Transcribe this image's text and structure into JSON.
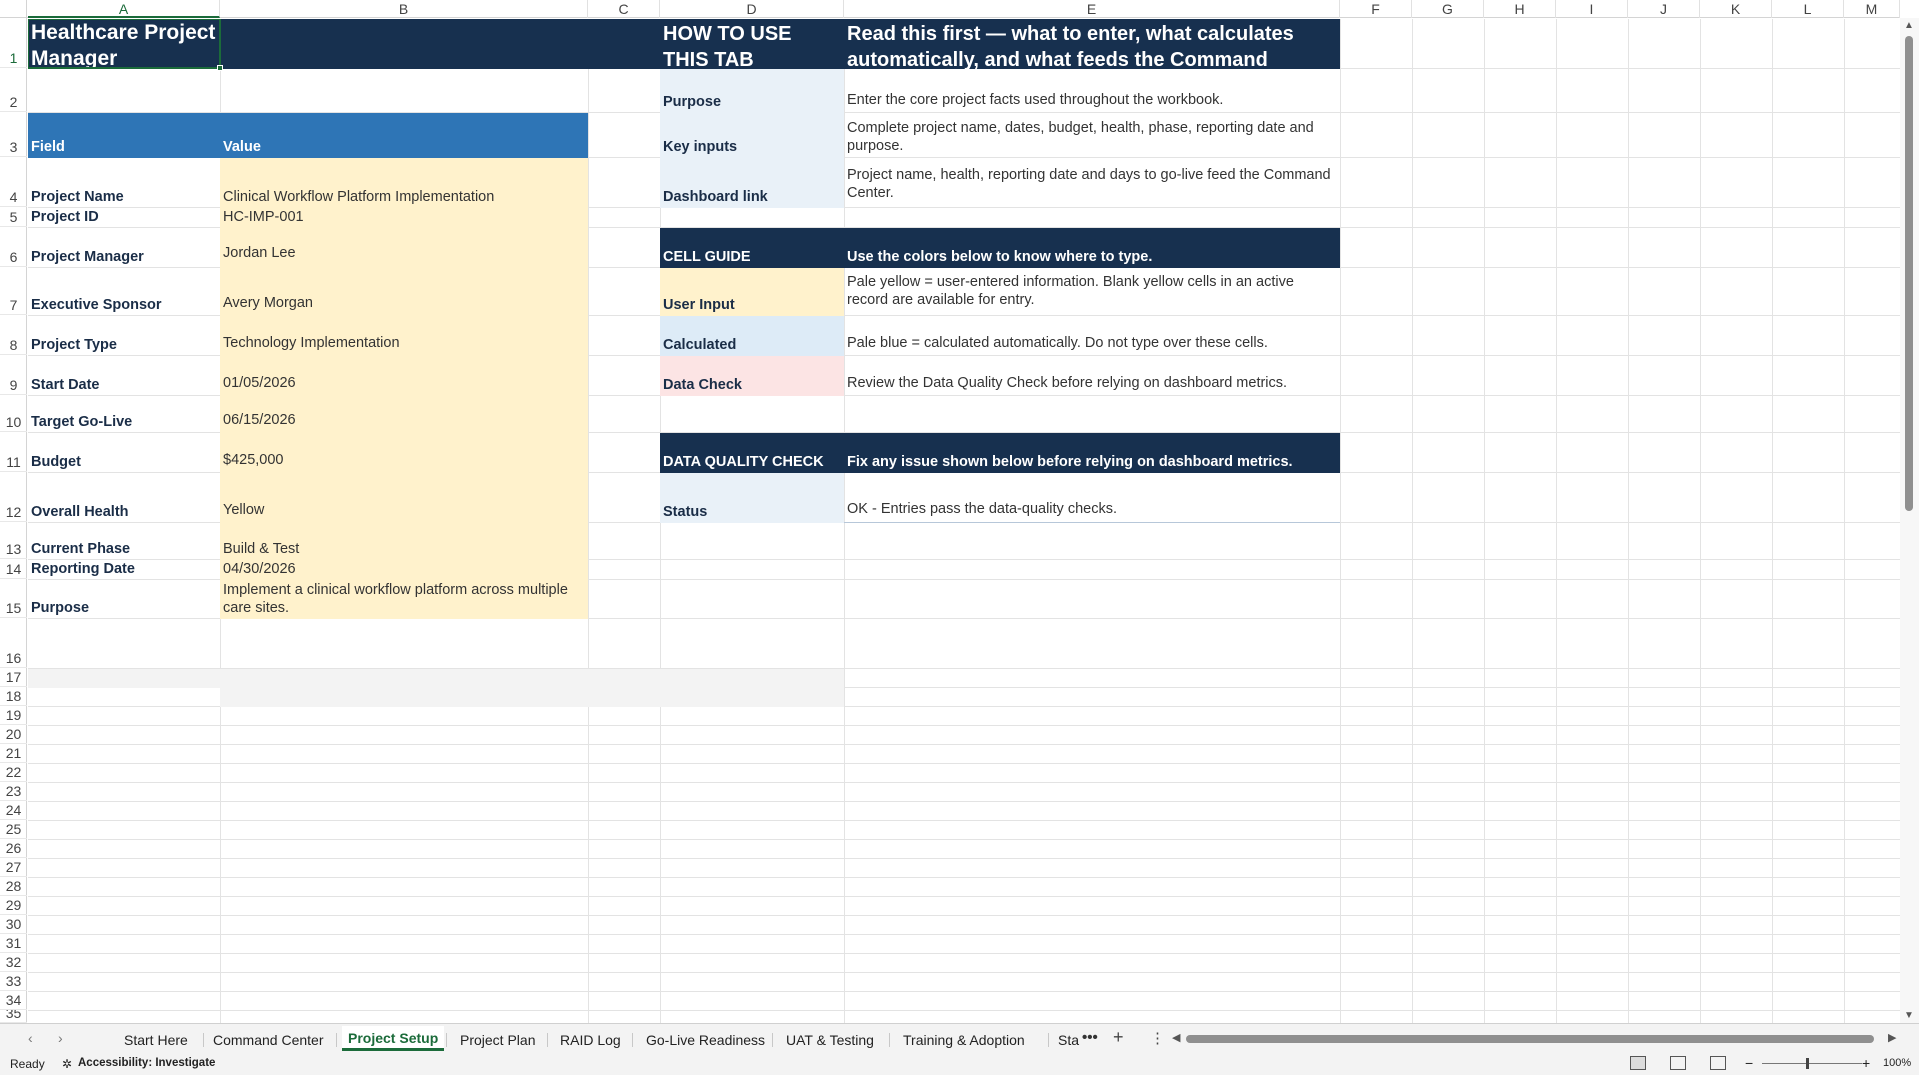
{
  "columns": [
    "A",
    "B",
    "C",
    "D",
    "E",
    "F",
    "G",
    "H",
    "I",
    "J",
    "K",
    "L",
    "M"
  ],
  "rows": [
    "1",
    "2",
    "3",
    "4",
    "5",
    "6",
    "7",
    "8",
    "9",
    "10",
    "11",
    "12",
    "13",
    "14",
    "15",
    "16",
    "17",
    "18",
    "19",
    "20",
    "21",
    "22",
    "23",
    "24",
    "25",
    "26",
    "27",
    "28",
    "29",
    "30",
    "31",
    "32",
    "33",
    "34",
    "35"
  ],
  "title": "Healthcare Project Manager",
  "setup": {
    "field_header": "Field",
    "value_header": "Value",
    "fields": [
      {
        "label": "Project Name",
        "value": "Clinical Workflow Platform Implementation"
      },
      {
        "label": "Project ID",
        "value": "HC-IMP-001"
      },
      {
        "label": "Project Manager",
        "value": "Jordan Lee"
      },
      {
        "label": "Executive Sponsor",
        "value": "Avery Morgan"
      },
      {
        "label": "Project Type",
        "value": "Technology Implementation"
      },
      {
        "label": "Start Date",
        "value": "01/05/2026"
      },
      {
        "label": "Target Go-Live",
        "value": "06/15/2026"
      },
      {
        "label": "Budget",
        "value": "$425,000"
      },
      {
        "label": "Overall Health",
        "value": "Yellow"
      },
      {
        "label": "Current Phase",
        "value": "Build & Test"
      },
      {
        "label": "Reporting Date",
        "value": "04/30/2026"
      },
      {
        "label": "Purpose",
        "value": "Implement a clinical workflow platform across multiple care sites."
      }
    ]
  },
  "howto": {
    "header_left": "HOW TO USE THIS TAB",
    "header_right": "Read this first — what to enter, what calculates automatically, and what feeds the Command",
    "items": [
      {
        "label": "Purpose",
        "text": "Enter the core project facts used throughout the workbook."
      },
      {
        "label": "Key inputs",
        "text": "Complete project name, dates, budget, health, phase, reporting date and purpose."
      },
      {
        "label": "Dashboard link",
        "text": "Project name, health, reporting date and days to go-live feed the Command Center."
      }
    ]
  },
  "cell_guide": {
    "header_left": "CELL GUIDE",
    "header_right": "Use the colors below to know where to type.",
    "items": [
      {
        "label": "User Input",
        "text": "Pale yellow = user-entered information. Blank yellow cells in an active record are available for entry."
      },
      {
        "label": "Calculated",
        "text": "Pale blue = calculated automatically. Do not type over these cells."
      },
      {
        "label": "Data Check",
        "text": "Review the Data Quality Check before relying on dashboard metrics."
      }
    ]
  },
  "dq_check": {
    "header_left": "DATA QUALITY CHECK",
    "header_right": "Fix any issue shown below before relying on dashboard metrics.",
    "status_label": "Status",
    "status_text": "OK - Entries pass the data-quality checks."
  },
  "tabs": [
    "Start Here",
    "Command Center",
    "Project Setup",
    "Project Plan",
    "RAID Log",
    "Go-Live Readiness",
    "UAT & Testing",
    "Training & Adoption",
    "Sta"
  ],
  "active_tab": "Project Setup",
  "status": {
    "ready": "Ready",
    "accessibility": "Accessibility: Investigate",
    "zoom": "100%"
  },
  "colors": {
    "navy": "#17304f",
    "header_blue": "#2e75b6",
    "input_yellow": "#fff2cc",
    "calc_blue": "#ddebf7",
    "check_pink": "#fce4e4",
    "excel_green": "#1b6b3a"
  }
}
